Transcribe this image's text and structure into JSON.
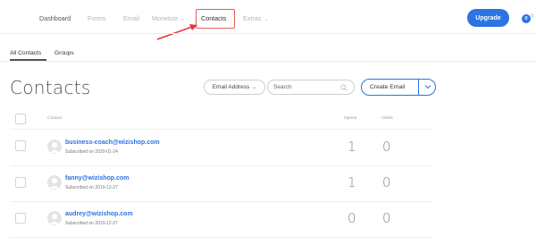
{
  "nav": {
    "items": [
      "Dashboard",
      "Forms",
      "Email",
      "Monetize",
      "Contacts",
      "Extras"
    ],
    "upgrade_label": "Upgrade",
    "notif_count": "0"
  },
  "tabs": [
    "All Contacts",
    "Groups"
  ],
  "page_title": "Contacts",
  "search": {
    "field_select": "Email Address",
    "placeholder": "Search",
    "create_label": "Create Email"
  },
  "table": {
    "headers": {
      "contact": "Contact",
      "opens": "Opens",
      "clicks": "Clicks"
    },
    "rows": [
      {
        "email": "business-coach@wizishop.com",
        "subscribed": "Subscribed on 2020-01-24",
        "opens": "1",
        "clicks": "0"
      },
      {
        "email": "fanny@wizishop.com",
        "subscribed": "Subscribed on 2019-12-27",
        "opens": "1",
        "clicks": "0"
      },
      {
        "email": "audrey@wizishop.com",
        "subscribed": "Subscribed on 2019-12-27",
        "opens": "0",
        "clicks": "0"
      }
    ]
  },
  "colors": {
    "accent": "#2b74e2",
    "highlight": "#e55a5a"
  }
}
